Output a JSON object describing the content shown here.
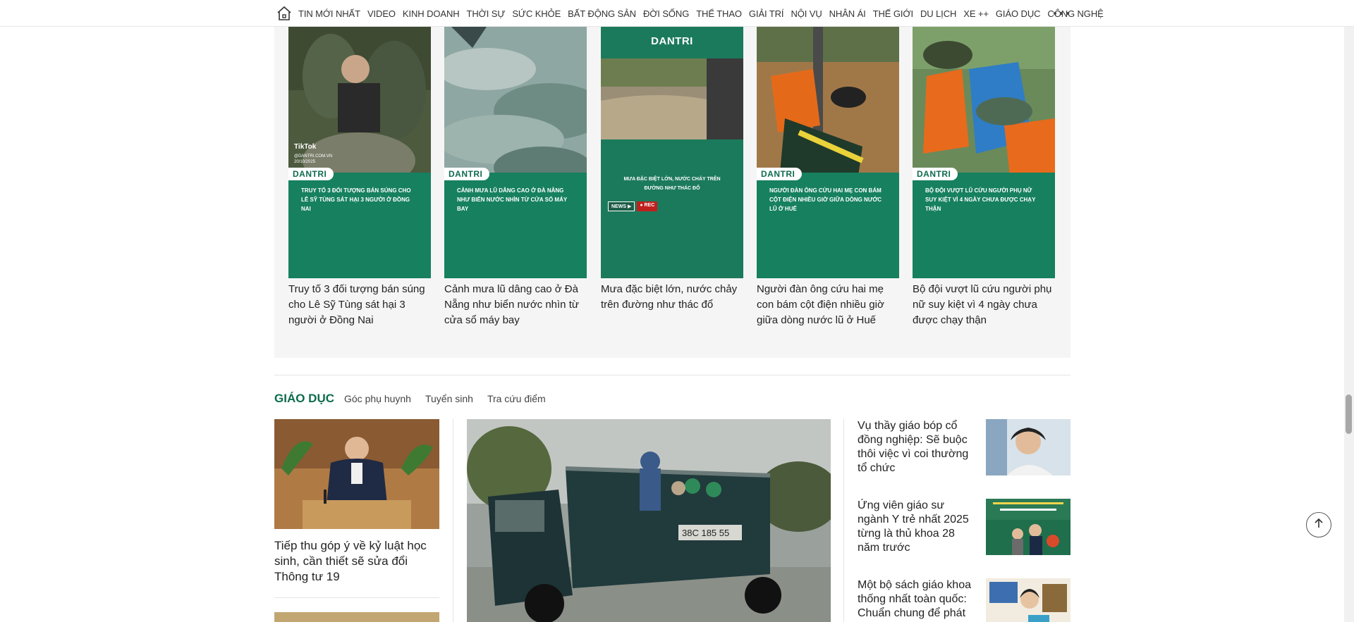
{
  "nav": {
    "items": [
      "TIN MỚI NHẤT",
      "VIDEO",
      "KINH DOANH",
      "THỜI SỰ",
      "SỨC KHỎE",
      "BẤT ĐỘNG SẢN",
      "ĐỜI SỐNG",
      "THỂ THAO",
      "GIẢI TRÍ",
      "NỘI VỤ",
      "NHÂN ÁI",
      "THẾ GIỚI",
      "DU LỊCH",
      "XE ++",
      "GIÁO DỤC",
      "CÔNG NGHỆ"
    ],
    "home_icon": "home-icon",
    "more_icon": "more-dots-icon"
  },
  "videos": [
    {
      "title": "Truy tố 3 đối tượng bán súng cho Lê Sỹ Tùng sát hại 3 người ở Đồng Nai",
      "brand": "DANTRI",
      "caption": "TRUY TỐ 3 ĐỐI TƯỢNG BÁN SÚNG CHO LÊ SỸ TÙNG SÁT HẠI 3 NGƯỜI Ở ĐỒNG NAI",
      "watermark": "TikTok",
      "handle": "@dantri.com.vn",
      "date": "20/10/2025"
    },
    {
      "title": "Cảnh mưa lũ dâng cao ở Đà Nẵng như biển nước nhìn từ cửa sổ máy bay",
      "brand": "DANTRI",
      "caption": "CẢNH MƯA LŨ DÂNG CAO Ở ĐÀ NẴNG NHƯ BIỂN NƯỚC NHÌN TỪ CỬA SỔ MÁY BAY"
    },
    {
      "title": "Mưa đặc biệt lớn, nước chảy trên đường như thác đổ",
      "brand": "DANTRI",
      "caption": "MƯA ĐẶC BIỆT LỚN, NƯỚC CHẢY TRÊN ĐƯỜNG NHƯ THÁC ĐỔ",
      "badge1": "NEWS ▶",
      "badge2": "● REC"
    },
    {
      "title": "Người đàn ông cứu hai mẹ con bám cột điện nhiều giờ giữa dòng nước lũ ở Huế",
      "brand": "DANTRI",
      "caption": "NGƯỜI ĐÀN ÔNG CỨU HAI MẸ CON BÁM CỘT ĐIỆN NHIỀU GIỜ GIỮA DÒNG NƯỚC LŨ Ở HUẾ"
    },
    {
      "title": "Bộ đội vượt lũ cứu người phụ nữ suy kiệt vì 4 ngày chưa được chạy thận",
      "brand": "DANTRI",
      "caption": "BỘ ĐỘI VƯỢT LŨ CỨU NGƯỜI PHỤ NỮ SUY KIỆT VÌ 4 NGÀY CHƯA ĐƯỢC CHẠY THẬN"
    }
  ],
  "section": {
    "title": "GIÁO DỤC",
    "subs": [
      "Góc phụ huynh",
      "Tuyển sinh",
      "Tra cứu điểm"
    ]
  },
  "left_article": {
    "title": "Tiếp thu góp ý về kỷ luật học sinh, cần thiết sẽ sửa đổi Thông tư 19"
  },
  "right_articles": [
    {
      "title": "Vụ thầy giáo bóp cổ đồng nghiệp: Sẽ buộc thôi việc vì coi thường tổ chức"
    },
    {
      "title": "Ứng viên giáo sư ngành Y trẻ nhất 2025 từng là thủ khoa 28 năm trước"
    },
    {
      "title": "Một bộ sách giáo khoa thống nhất toàn quốc: Chuẩn chung để phát"
    }
  ],
  "colors": {
    "brand_green": "#0d6b4d",
    "video_green": "#16805f"
  },
  "icons": {
    "back_to_top": "arrow-up-icon"
  }
}
